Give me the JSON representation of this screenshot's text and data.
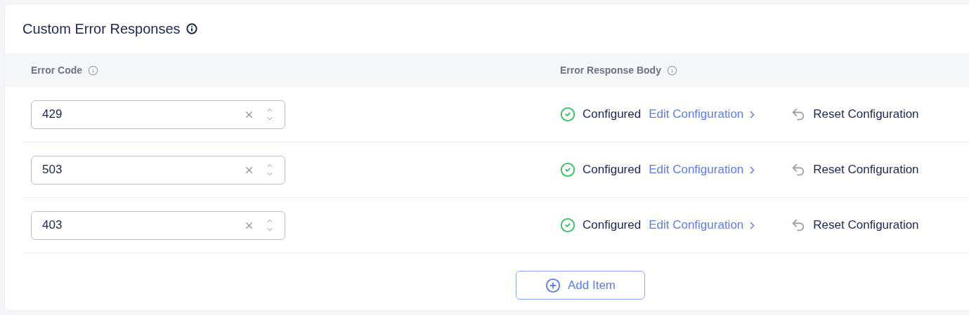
{
  "title": "Custom Error Responses",
  "table": {
    "columns": [
      "Error Code",
      "Error Response Body"
    ],
    "rows": [
      {
        "code": "429",
        "status": "Configured",
        "edit": "Edit Configuration",
        "reset": "Reset Configuration"
      },
      {
        "code": "503",
        "status": "Configured",
        "edit": "Edit Configuration",
        "reset": "Reset Configuration"
      },
      {
        "code": "403",
        "status": "Configured",
        "edit": "Edit Configuration",
        "reset": "Reset Configuration"
      }
    ]
  },
  "add_button": "Add Item"
}
